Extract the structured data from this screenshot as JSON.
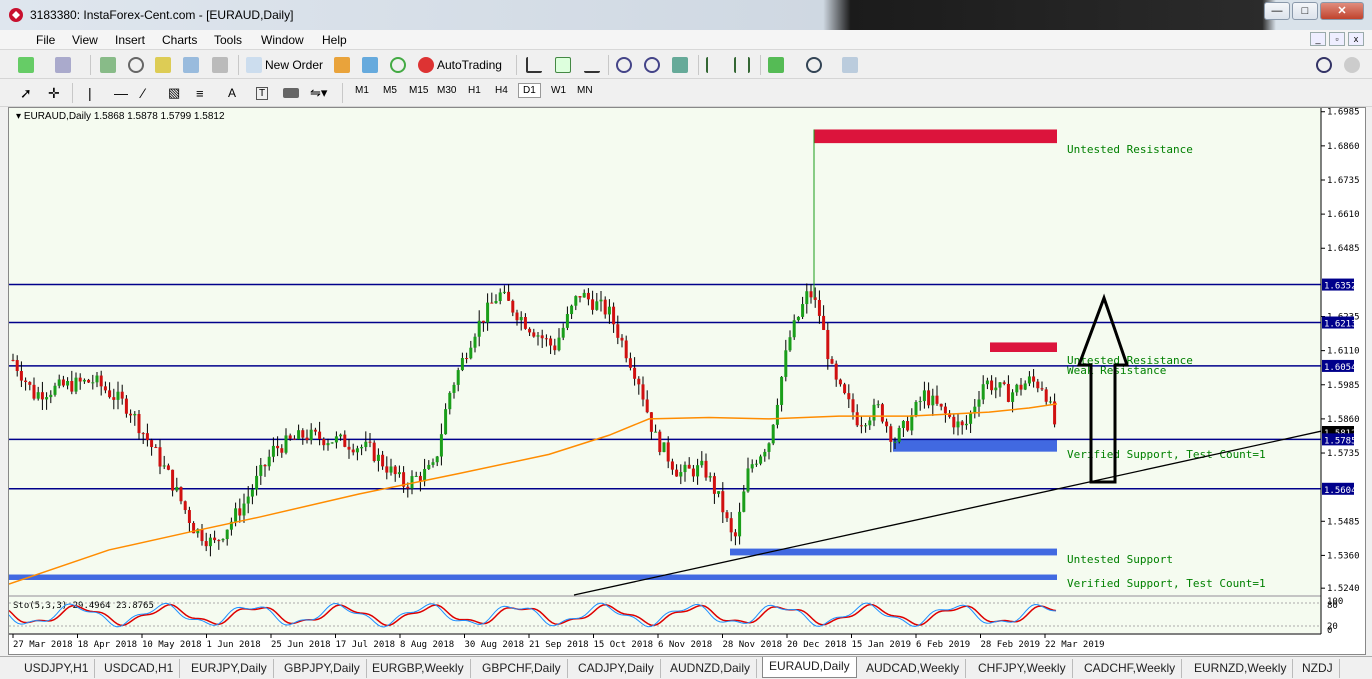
{
  "window": {
    "title": "3183380: InstaForex-Cent.com - [EURAUD,Daily]",
    "minimize": "—",
    "maximize": "□",
    "close": "✕"
  },
  "menu": [
    "File",
    "View",
    "Insert",
    "Charts",
    "Tools",
    "Window",
    "Help"
  ],
  "toolbar": {
    "new_order": "New Order",
    "autotrading": "AutoTrading",
    "timeframes": [
      "M1",
      "M5",
      "M15",
      "M30",
      "H1",
      "H4",
      "D1",
      "W1",
      "MN"
    ],
    "active_timeframe": "D1",
    "tool_a": "A",
    "tool_t": "T"
  },
  "chart": {
    "header": "EURAUD,Daily  1.5868 1.5878 1.5799 1.5812",
    "price_ticks": [
      "1.6985",
      "1.6860",
      "1.6735",
      "1.6610",
      "1.6485",
      "1.6352",
      "1.6235",
      "1.6213",
      "1.6110",
      "1.6054",
      "1.5985",
      "1.5860",
      "1.5812",
      "1.5785",
      "1.5735",
      "1.5604",
      "1.5485",
      "1.5360",
      "1.5240"
    ],
    "highlighted_prices": [
      "1.6352",
      "1.6213",
      "1.6054",
      "1.5812",
      "1.5785",
      "1.5604"
    ],
    "date_ticks": [
      "27 Mar 2018",
      "18 Apr 2018",
      "10 May 2018",
      "1 Jun 2018",
      "25 Jun 2018",
      "17 Jul 2018",
      "8 Aug 2018",
      "30 Aug 2018",
      "21 Sep 2018",
      "15 Oct 2018",
      "6 Nov 2018",
      "28 Nov 2018",
      "20 Dec 2018",
      "15 Jan 2019",
      "6 Feb 2019",
      "28 Feb 2019",
      "22 Mar 2019"
    ],
    "zones": [
      {
        "label": "Untested Resistance",
        "color": "#dc143c"
      },
      {
        "label": "Untested Resistance",
        "color": "#dc143c"
      },
      {
        "label": "Weak Resistance",
        "color": "#dc143c"
      },
      {
        "label": "Verified Support, Test Count=1",
        "color": "#4169e1"
      },
      {
        "label": "Untested Support",
        "color": "#4169e1"
      },
      {
        "label": "Verified Support, Test Count=1",
        "color": "#4169e1"
      }
    ],
    "stoch_label": "Sto(5,3,3) 29.4964 23.8765",
    "stoch_levels": [
      "100",
      "80",
      "20",
      "0"
    ],
    "colors": {
      "background": "#f5fbf0",
      "hline": "#00008b",
      "ma": "#ff8c00",
      "candle": "#000000",
      "text_zone": "#008000"
    }
  },
  "tabs": [
    "USDJPY,H1",
    "USDCAD,H1",
    "EURJPY,Daily",
    "GBPJPY,Daily",
    "EURGBP,Weekly",
    "GBPCHF,Daily",
    "CADJPY,Daily",
    "AUDNZD,Daily",
    "EURAUD,Daily",
    "AUDCAD,Weekly",
    "CHFJPY,Weekly",
    "CADCHF,Weekly",
    "EURNZD,Weekly",
    "NZDJ"
  ],
  "active_tab": "EURAUD,Daily"
}
